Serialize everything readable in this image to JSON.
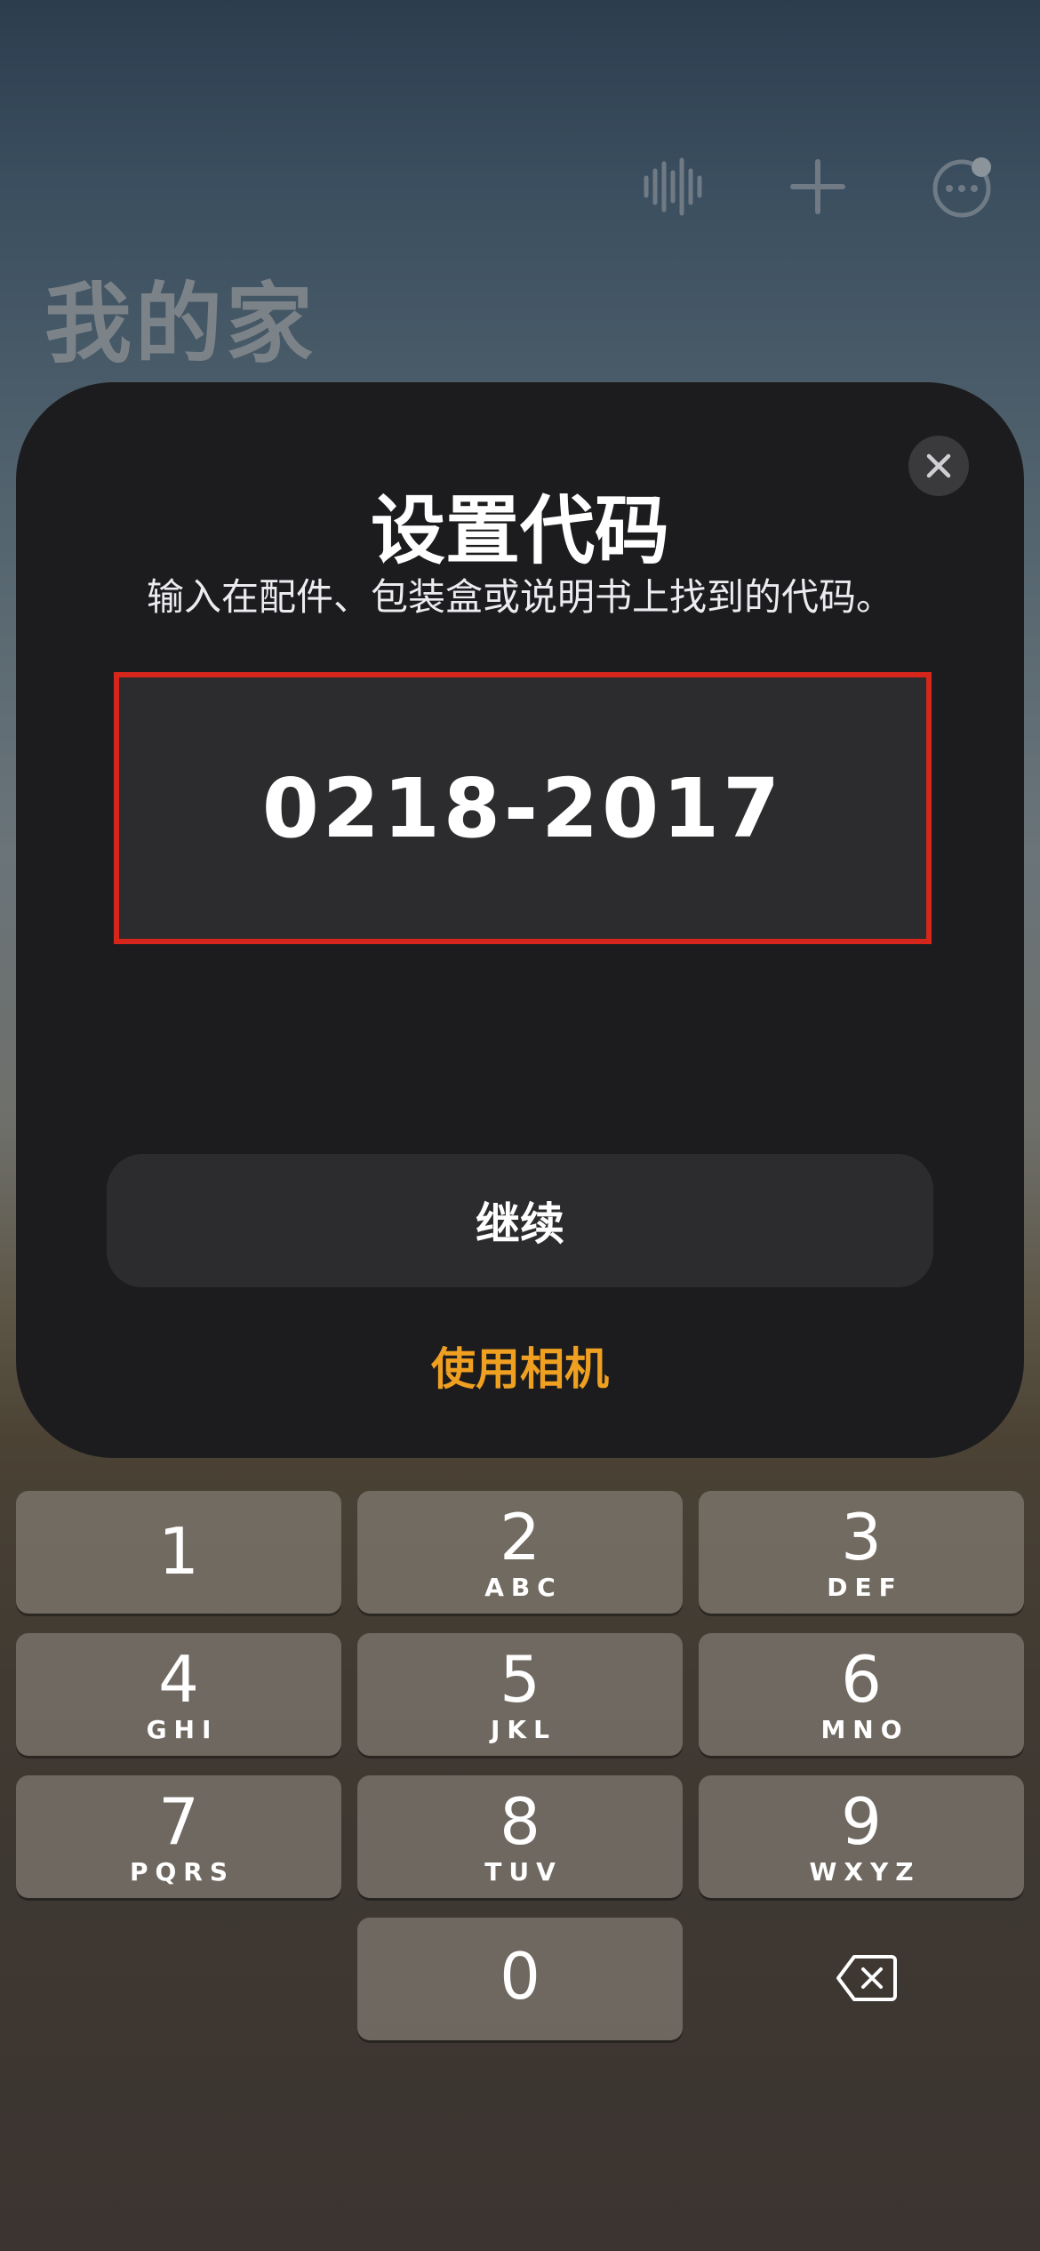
{
  "home": {
    "title": "我的家",
    "icons": [
      "voice-waveform-icon",
      "plus-icon",
      "more-ellipsis-icon"
    ]
  },
  "sheet": {
    "title": "设置代码",
    "subtitle": "输入在配件、包装盒或说明书上找到的代码。",
    "code": "0218-2017",
    "continue_label": "继续",
    "camera_label": "使用相机",
    "close_icon": "close-icon"
  },
  "keypad": {
    "keys": [
      {
        "digit": "1",
        "letters": ""
      },
      {
        "digit": "2",
        "letters": "ABC"
      },
      {
        "digit": "3",
        "letters": "DEF"
      },
      {
        "digit": "4",
        "letters": "GHI"
      },
      {
        "digit": "5",
        "letters": "JKL"
      },
      {
        "digit": "6",
        "letters": "MNO"
      },
      {
        "digit": "7",
        "letters": "PQRS"
      },
      {
        "digit": "8",
        "letters": "TUV"
      },
      {
        "digit": "9",
        "letters": "WXYZ"
      },
      {
        "digit": "0",
        "letters": ""
      }
    ],
    "backspace_icon": "backspace-icon"
  },
  "colors": {
    "sheet_bg": "#1c1c1e",
    "field_bg": "#2c2c2e",
    "highlight_border": "#d6261c",
    "accent": "#f0a020"
  }
}
